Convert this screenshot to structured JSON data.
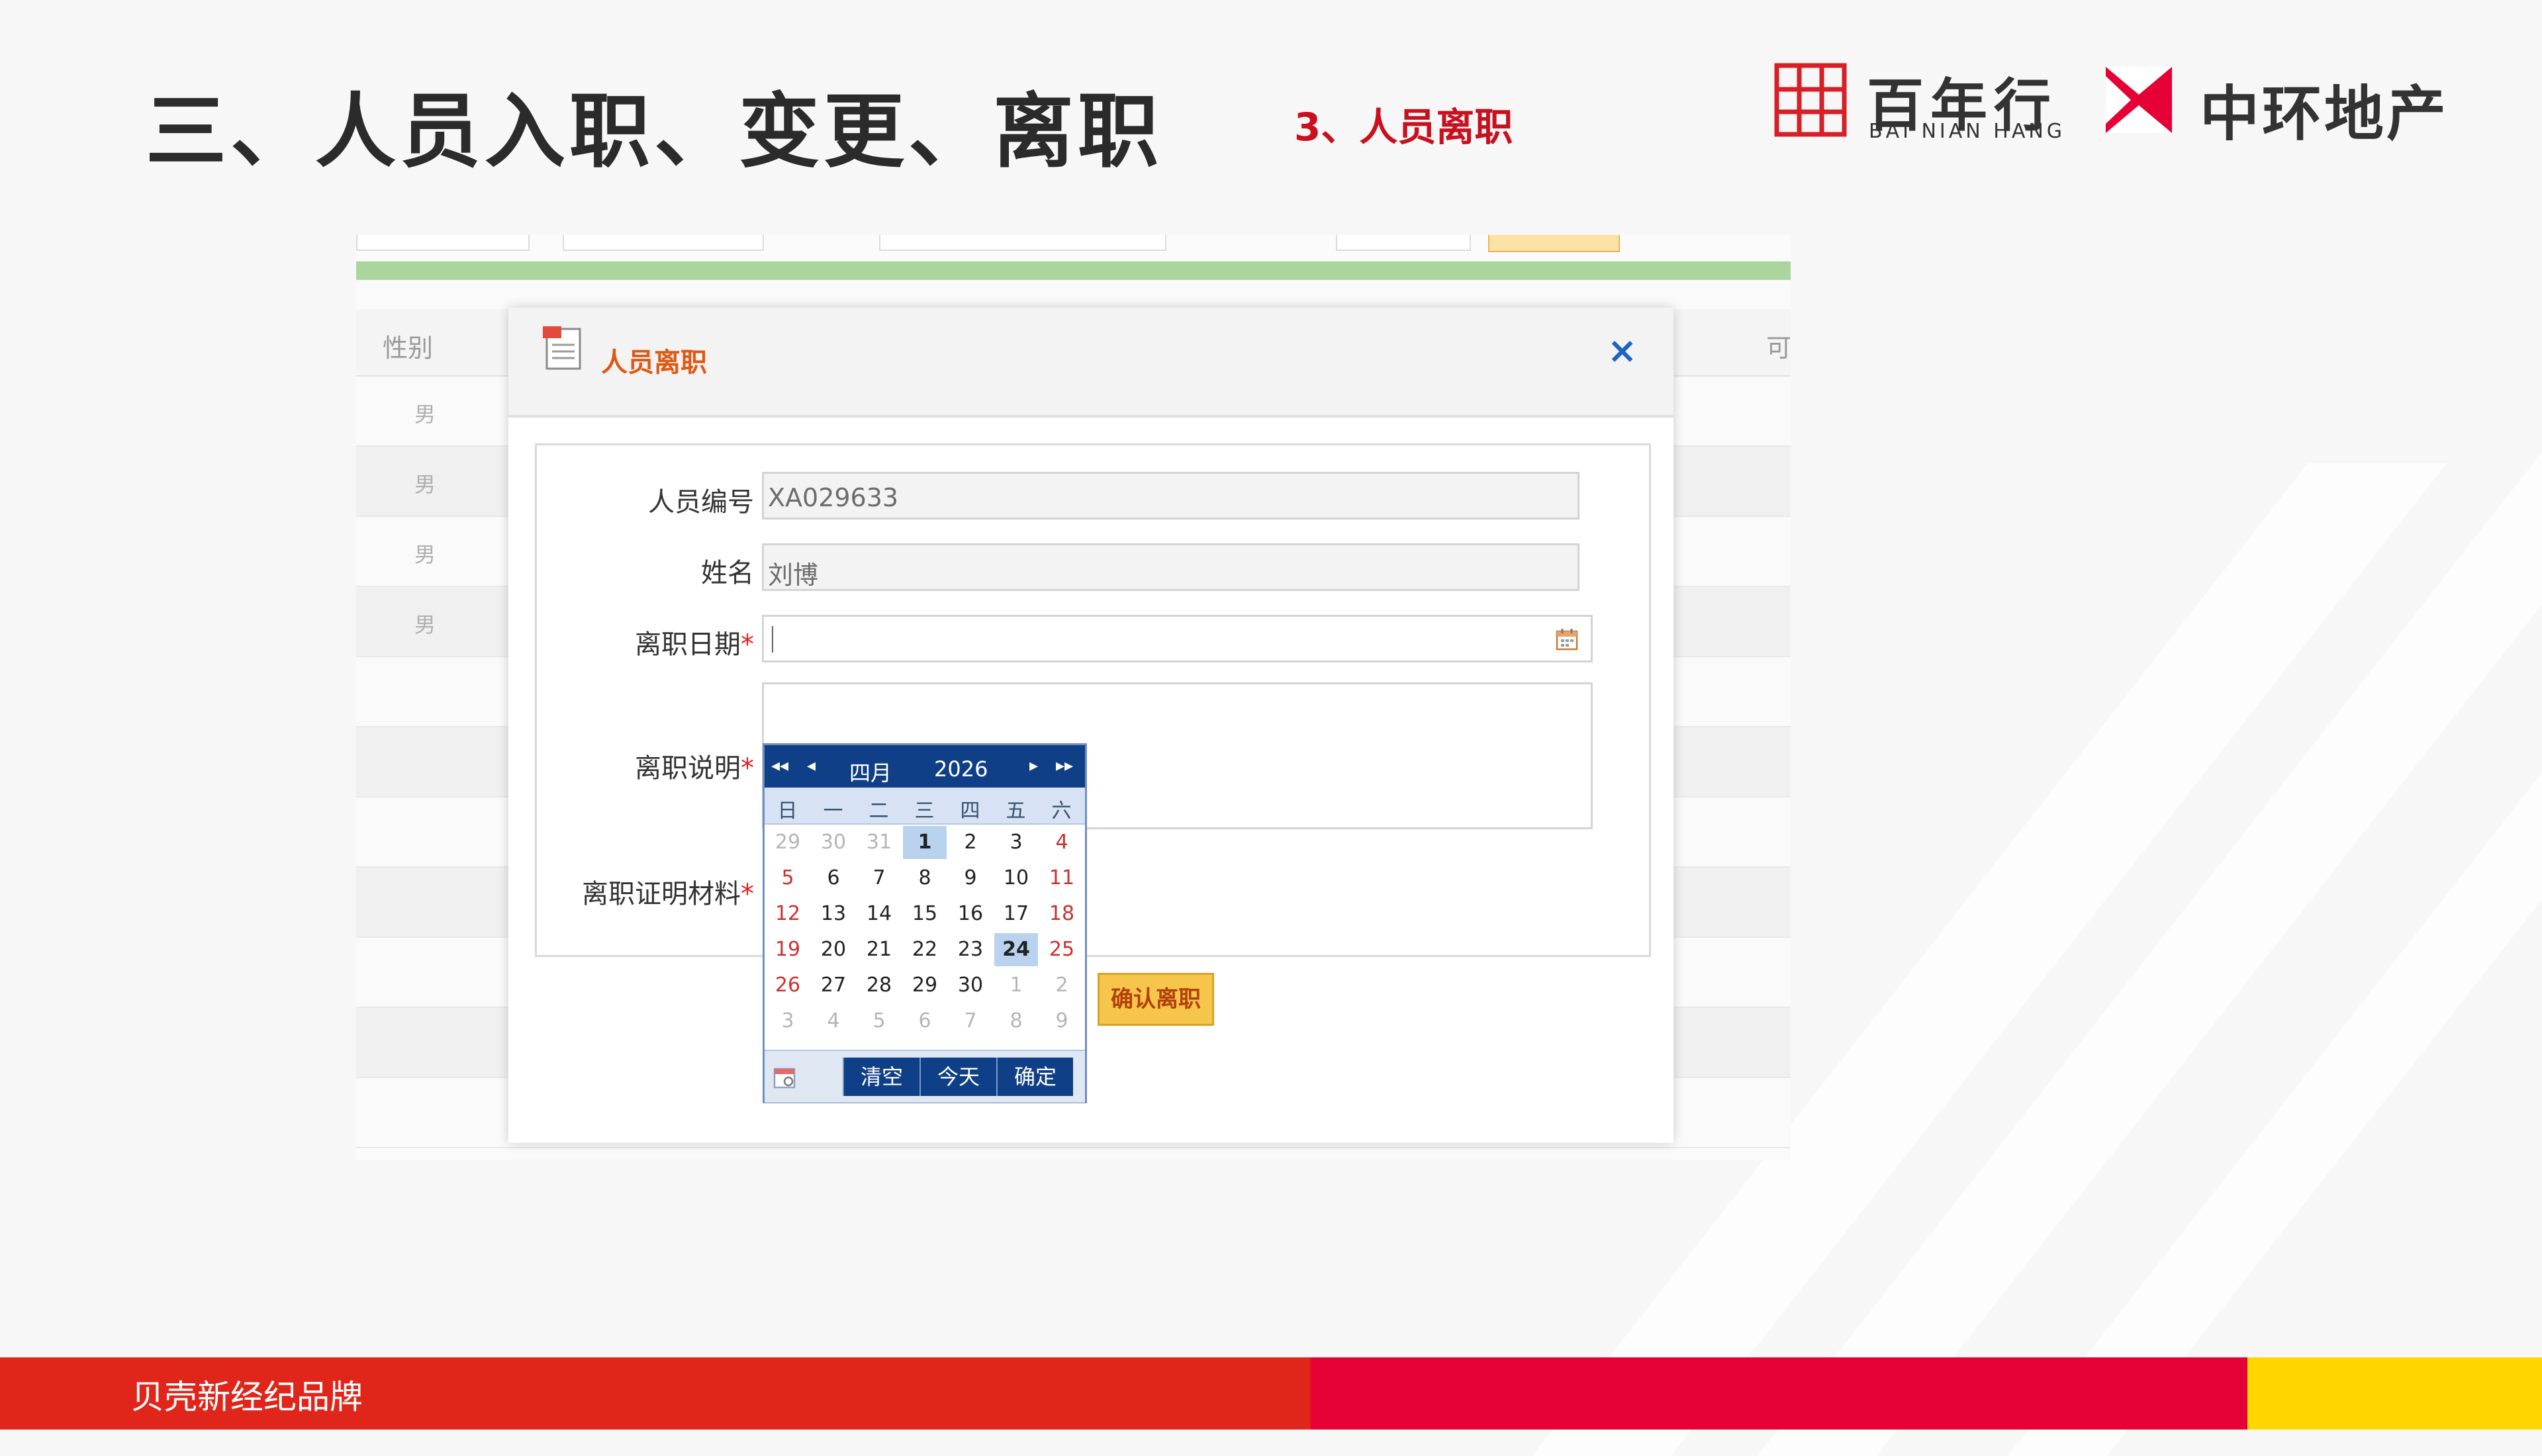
{
  "slide": {
    "title": "三、人员入职、变更、离职",
    "subtitle": "3、人员离职"
  },
  "logos": {
    "bainianhang_cn": "百年行",
    "bainianhang_en": "BAI NIAN HANG",
    "zhonghuan": "中环地产"
  },
  "footer": {
    "text": "贝壳新经纪品牌"
  },
  "colors": {
    "brand_red": "#e0251b",
    "brand_crimson": "#e50035",
    "brand_yellow": "#ffd600",
    "dialog_title": "#dc5a14",
    "calendar_header": "#0f3f86"
  },
  "table": {
    "header_left": "性别",
    "header_right": "可",
    "rows": [
      "男",
      "男",
      "男",
      "男",
      "",
      "",
      "",
      "",
      "",
      "",
      "",
      ""
    ]
  },
  "dialog": {
    "title": "人员离职",
    "close_icon": "×",
    "fields": {
      "employee_id": {
        "label": "人员编号",
        "value": "XA029633"
      },
      "name": {
        "label": "姓名",
        "value": "刘博"
      },
      "leave_date": {
        "label": "离职日期",
        "required_mark": "*",
        "value": ""
      },
      "leave_note": {
        "label": "离职说明",
        "required_mark": "*"
      },
      "leave_proof": {
        "label": "离职证明材料",
        "required_mark": "*"
      }
    },
    "confirm_button": "确认离职"
  },
  "calendar": {
    "nav": {
      "prev_year": "◂◂",
      "prev_month": "◂",
      "next_month": "▸",
      "next_year": "▸▸"
    },
    "month": "四月",
    "year": "2026",
    "weekdays": [
      "日",
      "一",
      "二",
      "三",
      "四",
      "五",
      "六"
    ],
    "weeks": [
      [
        "29",
        "30",
        "31",
        "1",
        "2",
        "3",
        "4"
      ],
      [
        "5",
        "6",
        "7",
        "8",
        "9",
        "10",
        "11"
      ],
      [
        "12",
        "13",
        "14",
        "15",
        "16",
        "17",
        "18"
      ],
      [
        "19",
        "20",
        "21",
        "22",
        "23",
        "24",
        "25"
      ],
      [
        "26",
        "27",
        "28",
        "29",
        "30",
        "1",
        "2"
      ],
      [
        "3",
        "4",
        "5",
        "6",
        "7",
        "8",
        "9"
      ]
    ],
    "selected": "1",
    "today": "24",
    "buttons": {
      "clear": "清空",
      "today": "今天",
      "ok": "确定"
    }
  }
}
